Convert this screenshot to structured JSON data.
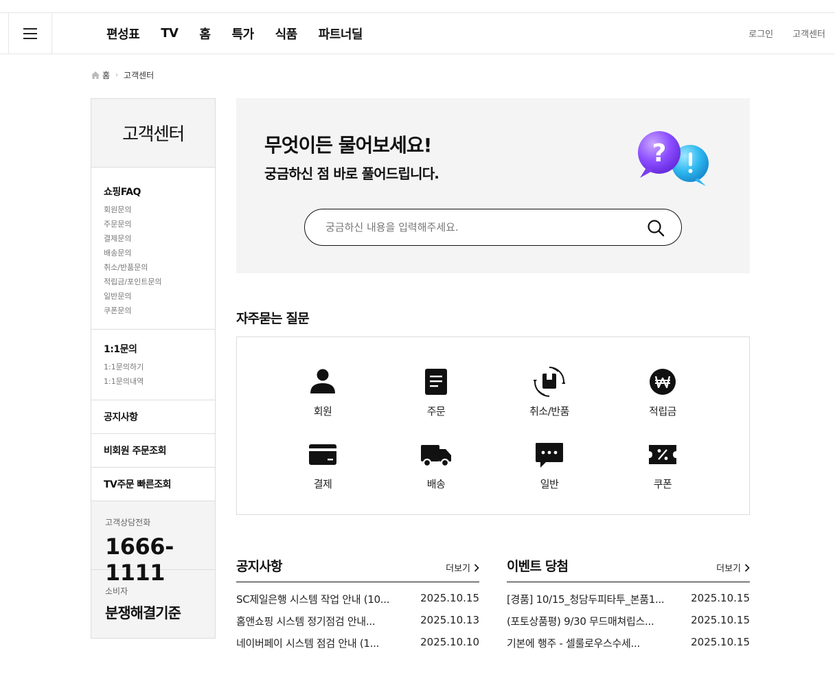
{
  "header": {
    "menu_label": "",
    "nav": [
      "편성표",
      "TV",
      "홈",
      "특가",
      "식품",
      "파트너딜"
    ],
    "util": [
      "로그인",
      "고객센터"
    ]
  },
  "breadcrumb": {
    "home": "홈",
    "current": "고객센터"
  },
  "sidebar": {
    "title": "고객센터",
    "faq": {
      "title": "쇼핑FAQ",
      "items": [
        "회원문의",
        "주문문의",
        "결제문의",
        "배송문의",
        "취소/반품문의",
        "적립금/포인트문의",
        "일반문의",
        "쿠폰문의"
      ]
    },
    "inquiry": {
      "title": "1:1문의",
      "items": [
        "1:1문의하기",
        "1:1문의내역"
      ]
    },
    "links": [
      "공지사항",
      "비회원 주문조회",
      "TV주문 빠른조회"
    ],
    "call": {
      "label": "고객상담전화",
      "number": "1666-1111"
    },
    "standard": {
      "label": "소비자",
      "title": "분쟁해결기준"
    }
  },
  "hero": {
    "title": "무엇이든 물어보세요!",
    "subtitle": "궁금하신 점 바로 풀어드립니다.",
    "search_placeholder": "궁금하신 내용을 입력해주세요.",
    "search_value": ""
  },
  "faq_section": {
    "title": "자주묻는 질문",
    "categories": [
      {
        "label": "회원",
        "icon": "person-icon"
      },
      {
        "label": "주문",
        "icon": "document-icon"
      },
      {
        "label": "취소/반품",
        "icon": "return-box-icon"
      },
      {
        "label": "적립금",
        "icon": "won-coin-icon"
      },
      {
        "label": "결제",
        "icon": "card-icon"
      },
      {
        "label": "배송",
        "icon": "truck-icon"
      },
      {
        "label": "일반",
        "icon": "chat-bubble-icon"
      },
      {
        "label": "쿠폰",
        "icon": "coupon-icon"
      }
    ]
  },
  "notice": {
    "title": "공지사항",
    "more": "더보기",
    "items": [
      {
        "title": "SC제일은행 시스템 작업 안내 (10...",
        "date": "2025.10.15"
      },
      {
        "title": "홈앤쇼핑 시스템 정기점검 안내...",
        "date": "2025.10.13"
      },
      {
        "title": "네이버페이 시스템 점검 안내 (1...",
        "date": "2025.10.10"
      }
    ]
  },
  "event": {
    "title": "이벤트 당첨",
    "more": "더보기",
    "items": [
      {
        "title": "[경품] 10/15_청담두피타투_본품1...",
        "date": "2025.10.15"
      },
      {
        "title": "(포토상품평) 9/30 무드매쳐립스...",
        "date": "2025.10.15"
      },
      {
        "title": "기본에 행주 - 셀룰로우스수세...",
        "date": "2025.10.15"
      }
    ]
  },
  "colors": {
    "accent_purple": "#8b4dff",
    "accent_blue": "#2fb8f0",
    "text": "#111111",
    "panel": "#f4f4f4"
  }
}
